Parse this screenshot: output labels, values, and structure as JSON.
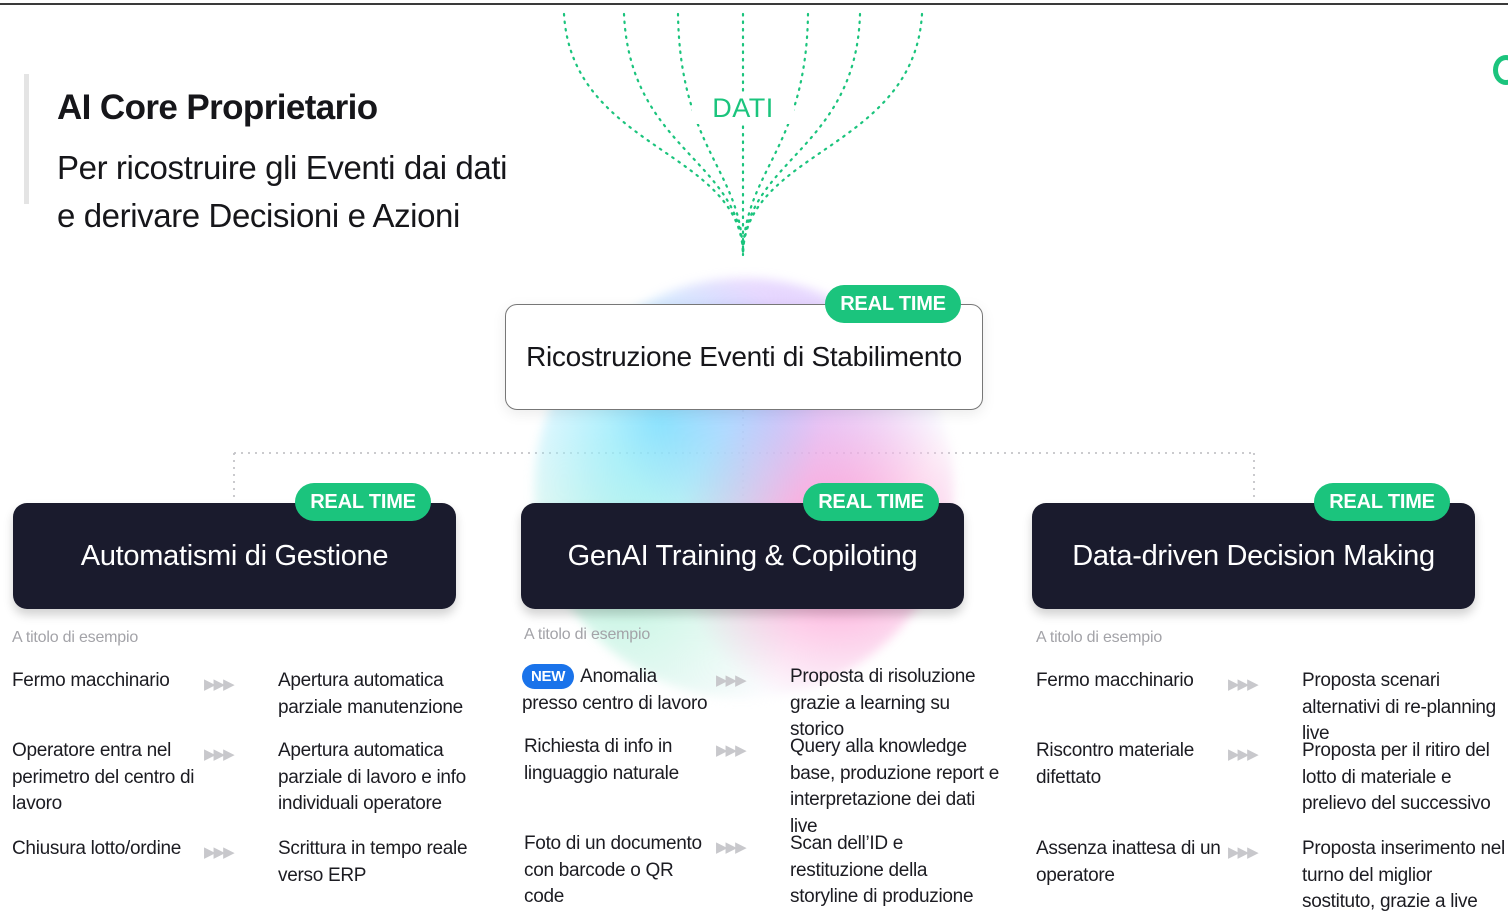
{
  "header": {
    "title": "AI Core Proprietario",
    "subtitle_line1": "Per ricostruire gli Eventi dai dati",
    "subtitle_line2": "e derivare Decisioni e Azioni"
  },
  "funnel": {
    "label": "DATI",
    "color": "#1bc47d"
  },
  "center": {
    "badge": "REAL TIME",
    "title": "Ricostruzione Eventi di Stabilimento"
  },
  "colors": {
    "accent": "#1bc47d",
    "dark_box": "#1a1b2d",
    "new_badge": "#1a73ea"
  },
  "columns": [
    {
      "badge": "REAL TIME",
      "title": "Automatismi di Gestione",
      "example_label": "A titolo di esempio",
      "rows": [
        {
          "trigger": "Fermo macchinario",
          "action": "Apertura automatica parziale manutenzione"
        },
        {
          "trigger": "Operatore entra nel perimetro del centro di lavoro",
          "action": "Apertura automatica parziale di lavoro e info individuali operatore"
        },
        {
          "trigger": "Chiusura lotto/ordine",
          "action": "Scrittura in tempo reale verso ERP"
        }
      ]
    },
    {
      "badge": "REAL TIME",
      "title": "GenAI Training & Copiloting",
      "example_label": "A titolo di esempio",
      "rows": [
        {
          "new_badge": "NEW",
          "trigger": "Anomalia presso centro di lavoro",
          "action": "Proposta di risoluzione grazie a learning su storico"
        },
        {
          "trigger": "Richiesta di info in linguaggio naturale",
          "action": "Query alla knowledge base, produzione report e interpretazione dei dati live"
        },
        {
          "trigger": "Foto di un documento con barcode o QR code",
          "action": "Scan dell’ID e restituzione della storyline di produzione associata"
        }
      ]
    },
    {
      "badge": "REAL TIME",
      "title": "Data-driven Decision Making",
      "example_label": "A titolo di esempio",
      "rows": [
        {
          "trigger": "Fermo macchinario",
          "action": "Proposta scenari alternativi di re-planning live"
        },
        {
          "trigger": "Riscontro materiale difettato",
          "action": "Proposta per il ritiro del lotto di materiale e prelievo del successivo"
        },
        {
          "trigger": "Assenza inattesa di un operatore",
          "action": "Proposta inserimento nel turno del miglior sostituto, grazie a live skill matrix"
        }
      ]
    }
  ]
}
